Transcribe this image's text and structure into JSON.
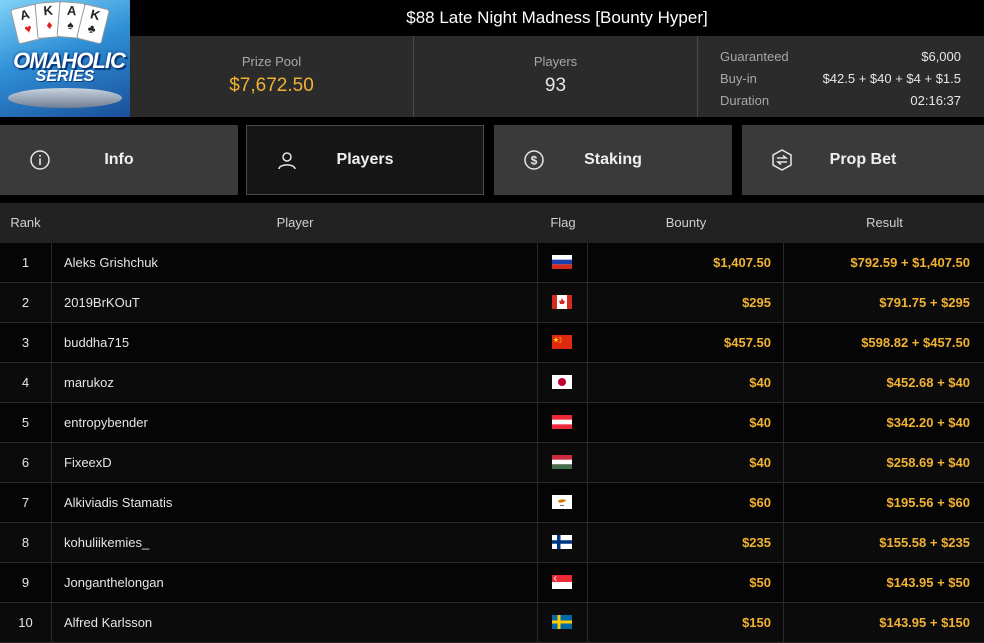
{
  "logo": {
    "cards": [
      "A",
      "K",
      "A",
      "K"
    ],
    "brand_text": "OMAHOLIC",
    "series_text": "SERIES"
  },
  "tournament": {
    "title": "$88 Late Night Madness [Bounty Hyper]"
  },
  "stats": {
    "prize_pool_label": "Prize Pool",
    "prize_pool_value": "$7,672.50",
    "players_label": "Players",
    "players_value": "93",
    "details": [
      {
        "key": "Guaranteed",
        "value": "$6,000"
      },
      {
        "key": "Buy-in",
        "value": "$42.5 + $40 + $4 + $1.5"
      },
      {
        "key": "Duration",
        "value": "02:16:37"
      }
    ]
  },
  "tabs": [
    {
      "label": "Info",
      "icon": "info-icon"
    },
    {
      "label": "Players",
      "icon": "user-icon"
    },
    {
      "label": "Staking",
      "icon": "dollar-coin-icon"
    },
    {
      "label": "Prop Bet",
      "icon": "prop-bet-icon"
    }
  ],
  "table": {
    "headers": {
      "rank": "Rank",
      "player": "Player",
      "flag": "Flag",
      "bounty": "Bounty",
      "result": "Result"
    },
    "rows": [
      {
        "rank": "1",
        "player": "Aleks Grishchuk",
        "flag": "russia",
        "bounty": "$1,407.50",
        "result": "$792.59 + $1,407.50"
      },
      {
        "rank": "2",
        "player": "2019BrKOuT",
        "flag": "canada",
        "bounty": "$295",
        "result": "$791.75 + $295"
      },
      {
        "rank": "3",
        "player": "buddha715",
        "flag": "china",
        "bounty": "$457.50",
        "result": "$598.82 + $457.50"
      },
      {
        "rank": "4",
        "player": "marukoz",
        "flag": "japan",
        "bounty": "$40",
        "result": "$452.68 + $40"
      },
      {
        "rank": "5",
        "player": "entropybender",
        "flag": "austria",
        "bounty": "$40",
        "result": "$342.20 + $40"
      },
      {
        "rank": "6",
        "player": "FixeexD",
        "flag": "hungary",
        "bounty": "$40",
        "result": "$258.69 + $40"
      },
      {
        "rank": "7",
        "player": "Alkiviadis Stamatis",
        "flag": "cyprus",
        "bounty": "$60",
        "result": "$195.56 + $60"
      },
      {
        "rank": "8",
        "player": "kohuliikemies_",
        "flag": "finland",
        "bounty": "$235",
        "result": "$155.58 + $235"
      },
      {
        "rank": "9",
        "player": "Jonganthelongan",
        "flag": "singapore",
        "bounty": "$50",
        "result": "$143.95 + $50"
      },
      {
        "rank": "10",
        "player": "Alfred Karlsson",
        "flag": "sweden",
        "bounty": "$150",
        "result": "$143.95 + $150"
      }
    ]
  },
  "colors": {
    "gold": "#f2b233",
    "tab_bg": "#3a3a3a",
    "tab_active_bg": "#161616"
  }
}
